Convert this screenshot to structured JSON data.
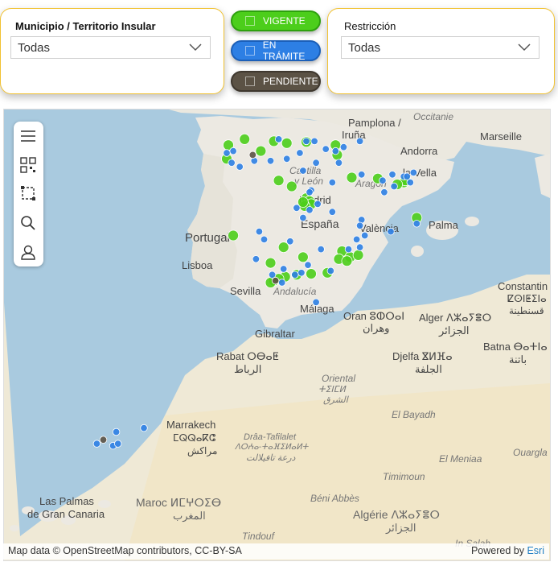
{
  "filters": {
    "municipio": {
      "label": "Municipio / Territorio Insular",
      "value": "Todas"
    },
    "restriccion": {
      "label": "Restricción",
      "value": "Todas"
    }
  },
  "legend": [
    {
      "label": "VIGENTE",
      "color": "#4cce1b"
    },
    {
      "label": "EN TRÁMITE",
      "color": "#2d7fe4"
    },
    {
      "label": "PENDIENTE",
      "color": "#5b5245"
    }
  ],
  "map": {
    "toolbar_icons": [
      "menu-icon",
      "qr-code-icon",
      "select-area-icon",
      "search-icon",
      "user-icon"
    ],
    "labels": {
      "occitanie": "Occitanie",
      "marseille": "Marseille",
      "pamplona1": "Pamplona /",
      "pamplona2": "Iruña",
      "andorra1": "Andorra",
      "andorra2": "la Vella",
      "castilla": "Castilla",
      "leon": "y León",
      "aragon": "Aragón",
      "madrid": "Madrid",
      "espana": "España",
      "valencia": "València",
      "palma": "Palma",
      "portugal": "Portugal",
      "lisboa": "Lisboa",
      "sevilla": "Sevilla",
      "andalucia": "Andalucía",
      "malaga": "Málaga",
      "gibraltar": "Gibraltar",
      "oran1": "Oran ⵓⵀⵔⴰⵏ",
      "oran2": "وهران",
      "alger1": "Alger ⴷⵣⴰⵢⴻⵔ",
      "alger2": "الجزائر",
      "constantine1": "Constantin",
      "constantine2": "ⵇⵙⵏⵟⵉⵏⴰ",
      "constantine3": "قسنطينة",
      "rabat1": "Rabat ⵔⴱⴰⵟ",
      "rabat2": "الرباط",
      "djelfa1": "Djelfa ⴵⵍⴼⴰ",
      "djelfa2": "الجلفة",
      "batna1": "Batna ⴱⴰⵜⵏⴰ",
      "batna2": "باتنة",
      "oriental1": "Oriental",
      "oriental2": "ⵜⵉⵏⵎⵍ",
      "oriental3": "الشرق",
      "elbayadh": "El Bayadh",
      "marrakech1": "Marrakech",
      "marrakech2": "ⵎⵕⵕⴰⴽⵛ",
      "marrakech3": "مراكش",
      "draa1": "Drâa-Tafilalet",
      "draa2": "ⴷⵔⵄⴰ-ⵜⴰⴼⵉⵍⴰⵍⵜ",
      "draa3": "درعة تافيلالت",
      "elmeniaa": "El Meniaa",
      "ouargla": "Ouargla",
      "timimoun": "Timimoun",
      "beniabbes": "Béni Abbès",
      "laspalmas1": "Las Palmas",
      "laspalmas2": "de Gran Canaria",
      "maroc1": "Maroc ⵍⵎⵖⵔⵉⴱ",
      "maroc2": "المغرب",
      "algerie1": "Algérie ⴷⵣⴰⵢⴻⵔ",
      "algerie2": "الجزائر",
      "tindouf": "Tindouf",
      "insalah": "In Salah"
    },
    "attribution": "Map data © OpenStreetMap contributors, CC-BY-SA",
    "powered_by": "Powered by",
    "esri": "Esri",
    "points_vigente": [
      [
        -8.6,
        43.3
      ],
      [
        -7.6,
        43.6
      ],
      [
        -5.8,
        43.5
      ],
      [
        -5.0,
        43.4
      ],
      [
        -3.8,
        43.46
      ],
      [
        -2.0,
        43.3
      ],
      [
        -1.9,
        42.8
      ],
      [
        -8.7,
        42.6
      ],
      [
        -6.6,
        43.0
      ],
      [
        -5.5,
        41.5
      ],
      [
        -4.7,
        41.2
      ],
      [
        -3.7,
        40.4
      ],
      [
        -3.8,
        40.6
      ],
      [
        -3.6,
        40.45
      ],
      [
        -3.5,
        40.3
      ],
      [
        -3.9,
        40.2
      ],
      [
        -4.0,
        40.4
      ],
      [
        -1.0,
        41.65
      ],
      [
        0.6,
        41.6
      ],
      [
        2.2,
        41.4
      ],
      [
        2.3,
        41.5
      ],
      [
        1.8,
        41.3
      ],
      [
        3.0,
        39.6
      ],
      [
        -8.3,
        38.7
      ],
      [
        -5.2,
        38.1
      ],
      [
        -4.0,
        37.6
      ],
      [
        -1.6,
        37.9
      ],
      [
        -1.8,
        37.5
      ],
      [
        -1.1,
        37.6
      ],
      [
        -0.6,
        37.7
      ],
      [
        -1.3,
        37.4
      ],
      [
        -6.0,
        37.3
      ],
      [
        -5.1,
        36.6
      ],
      [
        -5.8,
        36.4
      ],
      [
        -6.0,
        36.3
      ],
      [
        -4.4,
        36.7
      ],
      [
        -3.5,
        36.75
      ],
      [
        -2.5,
        36.8
      ],
      [
        -5.5,
        36.5
      ]
    ],
    "points_tramite": [
      [
        -8.3,
        43.0
      ],
      [
        -8.7,
        42.9
      ],
      [
        -8.4,
        42.4
      ],
      [
        -7.9,
        42.2
      ],
      [
        -7.0,
        42.5
      ],
      [
        -6.0,
        42.5
      ],
      [
        -4.2,
        42.9
      ],
      [
        -5.5,
        43.6
      ],
      [
        -3.8,
        43.5
      ],
      [
        -3.3,
        43.5
      ],
      [
        -2.6,
        43.1
      ],
      [
        -2.0,
        43.0
      ],
      [
        -1.5,
        43.2
      ],
      [
        -0.5,
        43.5
      ],
      [
        -1.8,
        42.4
      ],
      [
        -4.0,
        42.0
      ],
      [
        -3.2,
        42.4
      ],
      [
        -5.0,
        42.6
      ],
      [
        -3.5,
        41.0
      ],
      [
        -2.2,
        41.4
      ],
      [
        -0.4,
        41.8
      ],
      [
        0.9,
        41.5
      ],
      [
        1.5,
        41.8
      ],
      [
        2.2,
        41.7
      ],
      [
        2.8,
        41.9
      ],
      [
        2.6,
        41.4
      ],
      [
        1.6,
        41.2
      ],
      [
        1.0,
        40.9
      ],
      [
        2.4,
        41.7
      ],
      [
        -3.1,
        40.3
      ],
      [
        -3.6,
        40.9
      ],
      [
        -3.6,
        40.0
      ],
      [
        -4.4,
        40.1
      ],
      [
        -2.2,
        39.9
      ],
      [
        -4.0,
        39.6
      ],
      [
        -0.4,
        39.5
      ],
      [
        -0.5,
        39.2
      ],
      [
        -6.7,
        38.9
      ],
      [
        -6.4,
        38.5
      ],
      [
        -4.8,
        38.4
      ],
      [
        -2.9,
        38.0
      ],
      [
        -0.7,
        38.5
      ],
      [
        -1.2,
        38.0
      ],
      [
        -0.5,
        38.1
      ],
      [
        -0.2,
        38.7
      ],
      [
        -6.9,
        37.5
      ],
      [
        -5.2,
        37.0
      ],
      [
        -5.9,
        36.7
      ],
      [
        -5.3,
        36.3
      ],
      [
        -4.5,
        36.7
      ],
      [
        -2.3,
        36.9
      ],
      [
        -4.1,
        36.8
      ],
      [
        -3.7,
        37.2
      ],
      [
        -3.2,
        35.3
      ],
      [
        3.0,
        39.3
      ],
      [
        1.4,
        38.9
      ],
      [
        -15.7,
        28.0
      ],
      [
        -15.4,
        28.1
      ],
      [
        -15.5,
        28.7
      ],
      [
        -16.7,
        28.1
      ],
      [
        -13.8,
        28.9
      ]
    ],
    "points_pendiente": [
      [
        -7.1,
        42.8
      ],
      [
        -5.7,
        36.4
      ],
      [
        -16.3,
        28.3
      ]
    ]
  }
}
